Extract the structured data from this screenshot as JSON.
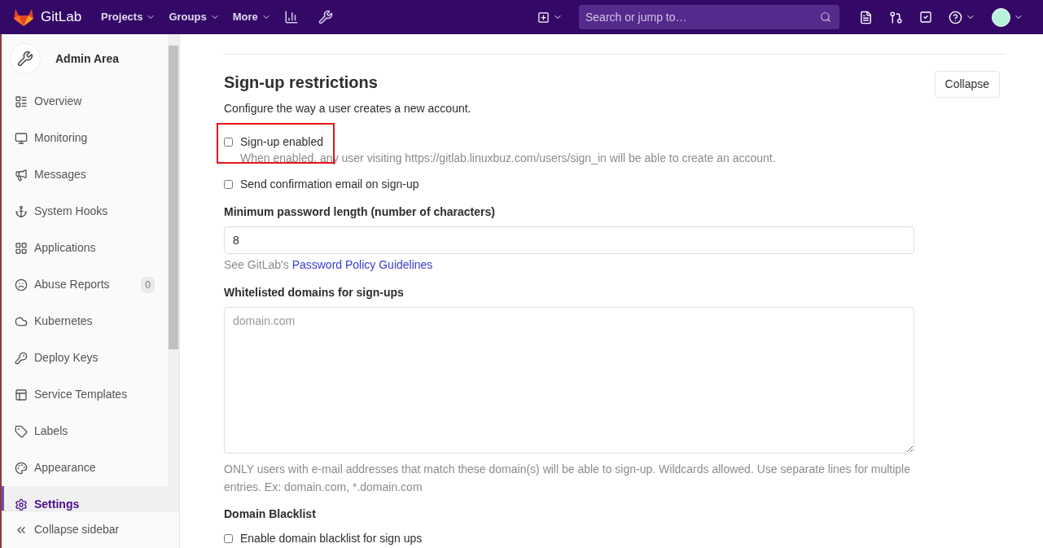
{
  "navbar": {
    "brand": "GitLab",
    "menus": [
      {
        "label": "Projects"
      },
      {
        "label": "Groups"
      },
      {
        "label": "More"
      }
    ],
    "search": {
      "placeholder": "Search or jump to…"
    }
  },
  "sidebar": {
    "title": "Admin Area",
    "items": [
      {
        "label": "Overview",
        "selected": false
      },
      {
        "label": "Monitoring",
        "selected": false
      },
      {
        "label": "Messages",
        "selected": false
      },
      {
        "label": "System Hooks",
        "selected": false
      },
      {
        "label": "Applications",
        "selected": false
      },
      {
        "label": "Abuse Reports",
        "selected": false,
        "badge": "0"
      },
      {
        "label": "Kubernetes",
        "selected": false
      },
      {
        "label": "Deploy Keys",
        "selected": false
      },
      {
        "label": "Service Templates",
        "selected": false
      },
      {
        "label": "Labels",
        "selected": false
      },
      {
        "label": "Appearance",
        "selected": false
      },
      {
        "label": "Settings",
        "selected": true
      }
    ],
    "collapse": "Collapse sidebar"
  },
  "section": {
    "title": "Sign-up restrictions",
    "description": "Configure the way a user creates a new account.",
    "collapse_button": "Collapse",
    "form": [
      {
        "kind": "checkbox",
        "label": "Sign-up enabled",
        "checked": false,
        "highlighted": true,
        "help": "When enabled, any user visiting https://gitlab.linuxbuz.com/users/sign_in will be able to create an account."
      },
      {
        "kind": "checkbox",
        "label": "Send confirmation email on sign-up",
        "checked": false
      },
      {
        "kind": "input",
        "label": "Minimum password length (number of characters)",
        "value": "8",
        "help": "See GitLab's",
        "link": "Password Policy Guidelines"
      },
      {
        "kind": "textarea",
        "label": "Whitelisted domains for sign-ups",
        "placeholder": "domain.com",
        "help": "ONLY users with e-mail addresses that match these domain(s) will be able to sign-up. Wildcards allowed. Use separate lines for multiple entries. Ex: domain.com, *.domain.com"
      },
      {
        "kind": "heading",
        "label": "Domain Blacklist"
      },
      {
        "kind": "checkbox",
        "label": "Enable domain blacklist for sign ups",
        "checked": false
      }
    ]
  }
}
